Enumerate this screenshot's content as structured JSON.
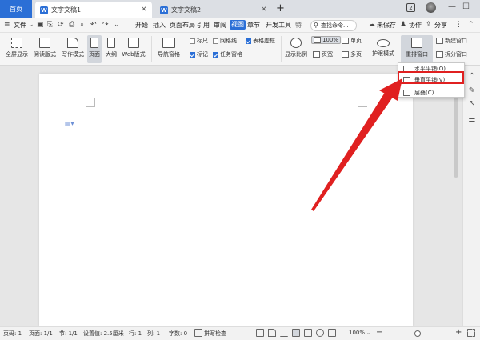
{
  "tabs": {
    "home": "首页",
    "doc1": "文字文稿1",
    "doc2": "文字文稿2",
    "doc_letter": "W",
    "window_count": "2"
  },
  "menu": {
    "file": "文件",
    "items": [
      "开始",
      "插入",
      "页面布局",
      "引用",
      "审阅",
      "视图",
      "章节",
      "开发工具",
      "特"
    ],
    "search": "查找命令...",
    "unsaved": "未保存",
    "collab": "协作",
    "share": "分享"
  },
  "ribbon": {
    "fullscreen": "全屏显示",
    "reading": "阅读版式",
    "writing": "写作模式",
    "page": "页面",
    "outline": "大纲",
    "web": "Web版式",
    "nav_pane": "导航窗格",
    "ruler": "标尺",
    "gridlines": "网格线",
    "table_dashed": "表格虚框",
    "marks": "标记",
    "task_pane": "任务窗格",
    "zoom_label": "显示比例",
    "zoom_value": "100%",
    "page_width": "页宽",
    "single_page": "单页",
    "multi_page": "多页",
    "eye_mode": "护眼模式",
    "arrange_window": "重排窗口",
    "new_window": "新建窗口",
    "split_window": "拆分窗口"
  },
  "dropdown": {
    "horizontal": "水平平铺(Q)",
    "vertical": "垂直平铺(V)",
    "cascade": "层叠(C)"
  },
  "status": {
    "page_num": "页码: 1",
    "pages": "页面: 1/1",
    "section": "节: 1/1",
    "setting": "设置值: 2.5厘米",
    "row": "行: 1",
    "col": "列: 1",
    "words": "字数: 0",
    "spell": "拼写检查",
    "zoom": "100%"
  },
  "colors": {
    "accent": "#2b6fd6",
    "highlight_red": "#e02020"
  }
}
